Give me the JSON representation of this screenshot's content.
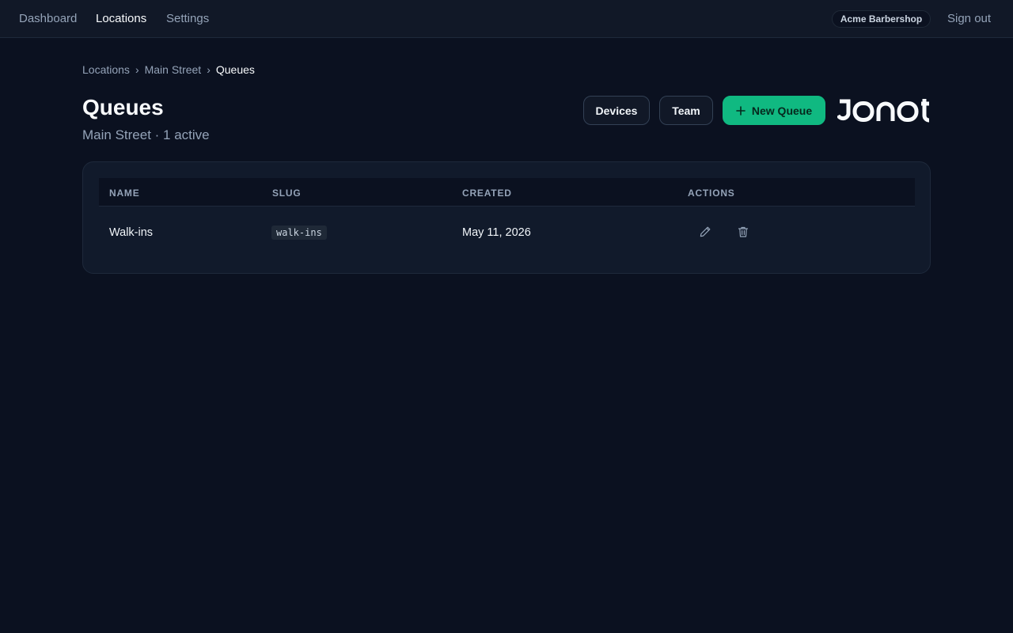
{
  "nav": {
    "items": [
      {
        "label": "Dashboard",
        "active": false
      },
      {
        "label": "Locations",
        "active": true
      },
      {
        "label": "Settings",
        "active": false
      }
    ],
    "org_name": "Acme Barbershop",
    "signout_label": "Sign out"
  },
  "breadcrumb": {
    "items": [
      "Locations",
      "Main Street",
      "Queues"
    ],
    "separator": "›"
  },
  "page": {
    "title": "Queues",
    "subtitle": "Main Street · 1 active"
  },
  "actions": {
    "devices_label": "Devices",
    "team_label": "Team",
    "new_queue_label": "New Queue",
    "new_queue_icon": "plus-icon"
  },
  "logo": {
    "text": "JONOT",
    "color": "#f8fafc"
  },
  "table": {
    "columns": [
      "NAME",
      "SLUG",
      "CREATED",
      "ACTIONS"
    ],
    "rows": [
      {
        "name": "Walk-ins",
        "slug": "walk-ins",
        "created": "May 11, 2026",
        "actions": [
          "pencil-icon",
          "trash-icon"
        ]
      }
    ]
  },
  "colors": {
    "background": "#0b1120",
    "accent": "#10b981",
    "muted": "#94a3b8"
  }
}
